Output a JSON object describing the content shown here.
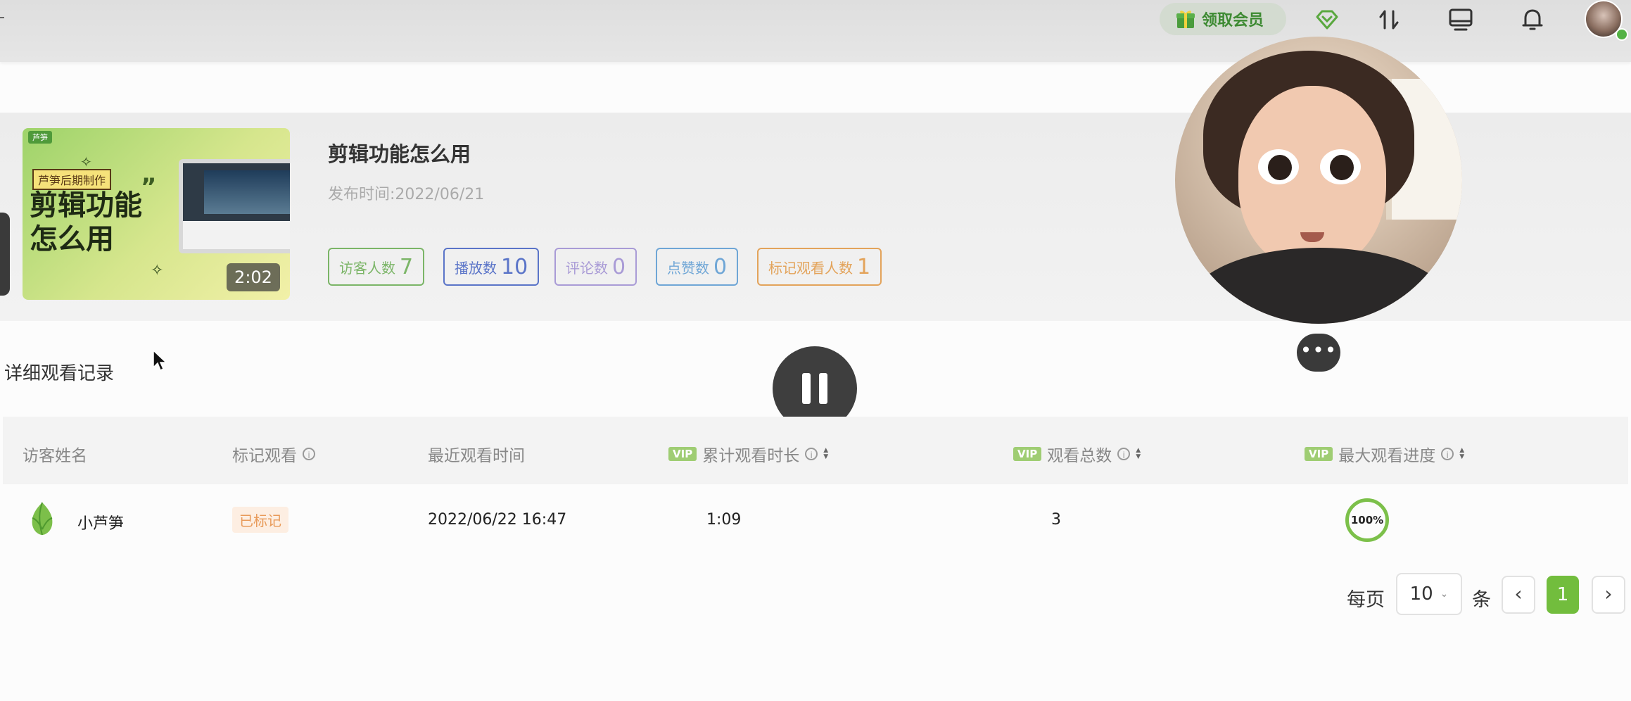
{
  "topbar": {
    "vip_label": "领取会员",
    "icons": [
      "gift-icon",
      "diamond-icon",
      "sort-arrows-icon",
      "monitor-icon",
      "bell-icon",
      "avatar"
    ],
    "brand_color": "#3d8a32"
  },
  "video": {
    "thumb_brand": "芦笋",
    "thumb_tag": "芦笋后期制作",
    "thumb_title_line1": "剪辑功能",
    "thumb_title_line2": "怎么用",
    "thumb_quote": "”",
    "duration": "2:02",
    "title": "剪辑功能怎么用",
    "publish_label": "发布时间:",
    "publish_date": "2022/06/21"
  },
  "stats": [
    {
      "label": "访客人数",
      "value": "7",
      "color": "#7bb567"
    },
    {
      "label": "播放数",
      "value": "10",
      "color": "#5a74c8"
    },
    {
      "label": "评论数",
      "value": "0",
      "color": "#a99bd6"
    },
    {
      "label": "点赞数",
      "value": "0",
      "color": "#6fa6d6"
    },
    {
      "label": "标记观看人数",
      "value": "1",
      "color": "#e3a35a"
    }
  ],
  "overlay": {
    "more_label": "•••"
  },
  "section": {
    "title": "详细观看记录"
  },
  "table": {
    "vip_label": "VIP",
    "columns": {
      "name": "访客姓名",
      "marked": "标记观看",
      "last_time": "最近观看时间",
      "total_duration": "累计观看时长",
      "total_count": "观看总数",
      "max_progress": "最大观看进度"
    },
    "rows": [
      {
        "name": "小芦笋",
        "marked": "已标记",
        "last_time": "2022/06/22 16:47",
        "total_duration": "1:09",
        "total_count": "3",
        "max_progress": "100%"
      }
    ]
  },
  "pagination": {
    "per_page_label": "每页",
    "per_page_value": "10",
    "unit_label": "条",
    "prev": "‹",
    "current_page": "1",
    "next": "›"
  }
}
